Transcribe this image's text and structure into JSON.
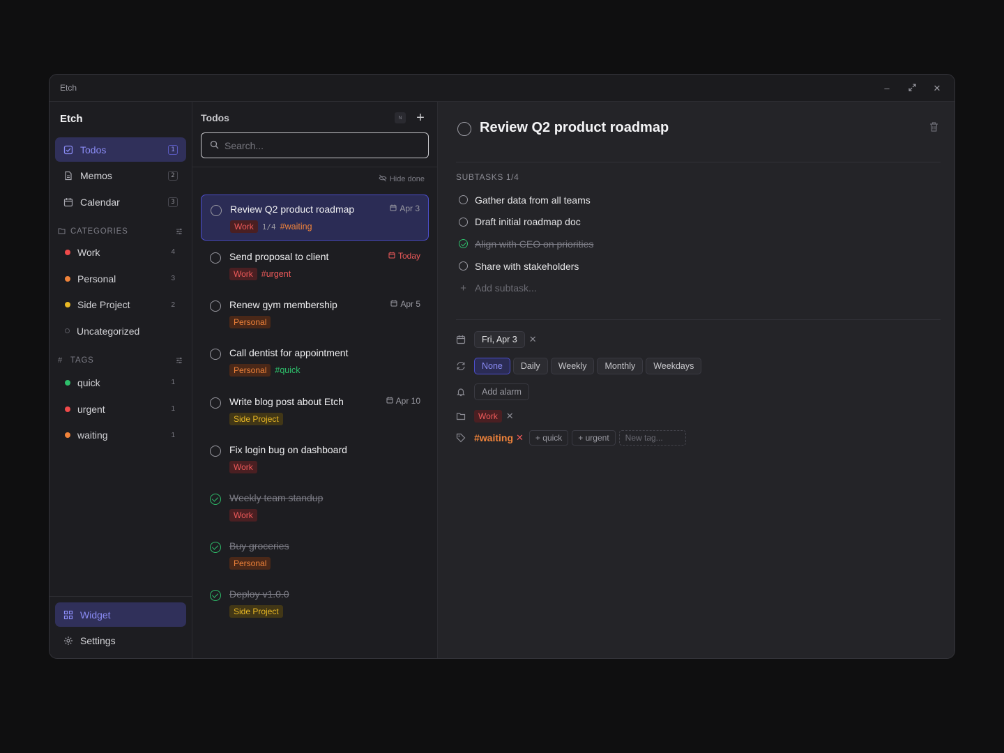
{
  "window": {
    "title": "Etch"
  },
  "sidebar": {
    "brand": "Etch",
    "nav": [
      {
        "label": "Todos",
        "count": "1",
        "icon": "checkbox-icon"
      },
      {
        "label": "Memos",
        "count": "2",
        "icon": "file-icon"
      },
      {
        "label": "Calendar",
        "count": "3",
        "icon": "calendar-icon"
      }
    ],
    "categories_header": "CATEGORIES",
    "categories": [
      {
        "label": "Work",
        "count": "4",
        "color": "#ef4a4a"
      },
      {
        "label": "Personal",
        "count": "3",
        "color": "#f0833a"
      },
      {
        "label": "Side Project",
        "count": "2",
        "color": "#e9b824"
      },
      {
        "label": "Uncategorized",
        "count": "",
        "color": ""
      }
    ],
    "tags_header": "TAGS",
    "tags": [
      {
        "label": "quick",
        "count": "1",
        "color": "#2ebf6b"
      },
      {
        "label": "urgent",
        "count": "1",
        "color": "#ef4a4a"
      },
      {
        "label": "waiting",
        "count": "1",
        "color": "#f0833a"
      }
    ],
    "footer": [
      {
        "label": "Widget",
        "icon": "grid-icon"
      },
      {
        "label": "Settings",
        "icon": "gear-icon"
      }
    ]
  },
  "todos_pane": {
    "title": "Todos",
    "shortcut": "N",
    "search_placeholder": "Search...",
    "hide_done": "Hide done",
    "items": [
      {
        "title": "Review Q2 product roadmap",
        "due": "Apr 3",
        "category": "Work",
        "subtasks": "1/4",
        "tag": "#waiting",
        "done": false
      },
      {
        "title": "Send proposal to client",
        "due": "Today",
        "category": "Work",
        "tag": "#urgent",
        "done": false
      },
      {
        "title": "Renew gym membership",
        "due": "Apr 5",
        "category": "Personal",
        "done": false
      },
      {
        "title": "Call dentist for appointment",
        "category": "Personal",
        "tag": "#quick",
        "done": false
      },
      {
        "title": "Write blog post about Etch",
        "due": "Apr 10",
        "category": "Side Project",
        "done": false
      },
      {
        "title": "Fix login bug on dashboard",
        "category": "Work",
        "done": false
      },
      {
        "title": "Weekly team standup",
        "category": "Work",
        "done": true
      },
      {
        "title": "Buy groceries",
        "category": "Personal",
        "done": true
      },
      {
        "title": "Deploy v1.0.0",
        "category": "Side Project",
        "done": true
      }
    ]
  },
  "detail": {
    "title": "Review Q2 product roadmap",
    "subtasks_header": "SUBTASKS 1/4",
    "subtasks": [
      {
        "label": "Gather data from all teams",
        "done": false
      },
      {
        "label": "Draft initial roadmap doc",
        "done": false
      },
      {
        "label": "Align with CEO on priorities",
        "done": true
      },
      {
        "label": "Share with stakeholders",
        "done": false
      }
    ],
    "add_subtask": "Add subtask...",
    "date": "Fri, Apr 3",
    "repeat": [
      "None",
      "Daily",
      "Weekly",
      "Monthly",
      "Weekdays"
    ],
    "repeat_selected": "None",
    "alarm": "Add alarm",
    "category": "Work",
    "tag_current": "#waiting",
    "tag_suggestions": [
      "+ quick",
      "+ urgent"
    ],
    "new_tag_placeholder": "New tag..."
  }
}
